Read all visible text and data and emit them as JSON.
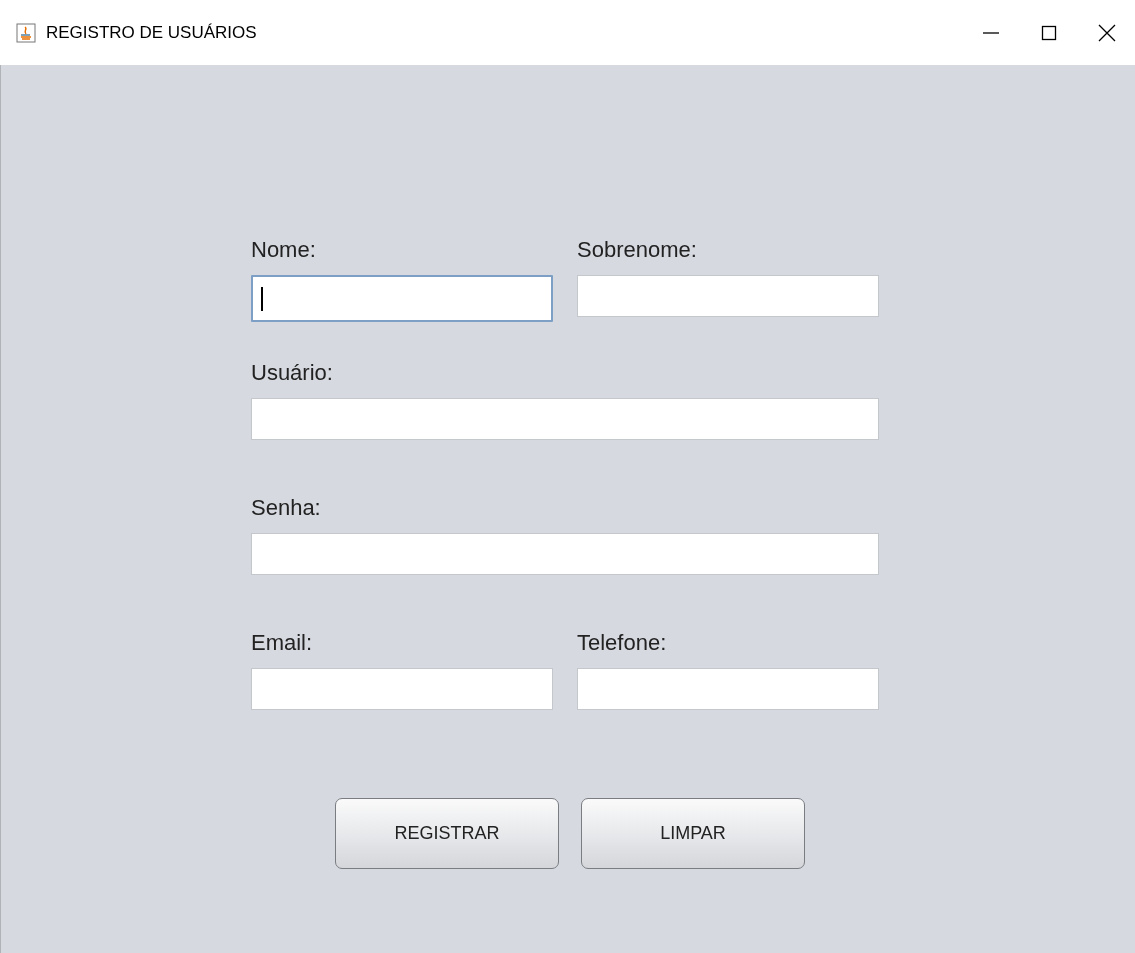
{
  "window": {
    "title": "REGISTRO DE USUÁRIOS"
  },
  "fields": [
    {
      "label": "Nome:",
      "kind": "half",
      "focused": true
    },
    {
      "label": "Sobrenome:",
      "kind": "half",
      "focused": false
    },
    {
      "label": "Usuário:",
      "kind": "full",
      "focused": false
    },
    {
      "label": "Senha:",
      "kind": "full",
      "focused": false
    },
    {
      "label": "Email:",
      "kind": "half",
      "focused": false
    },
    {
      "label": "Telefone:",
      "kind": "half",
      "focused": false
    }
  ],
  "buttons": [
    "REGISTRAR",
    "LIMPAR"
  ]
}
